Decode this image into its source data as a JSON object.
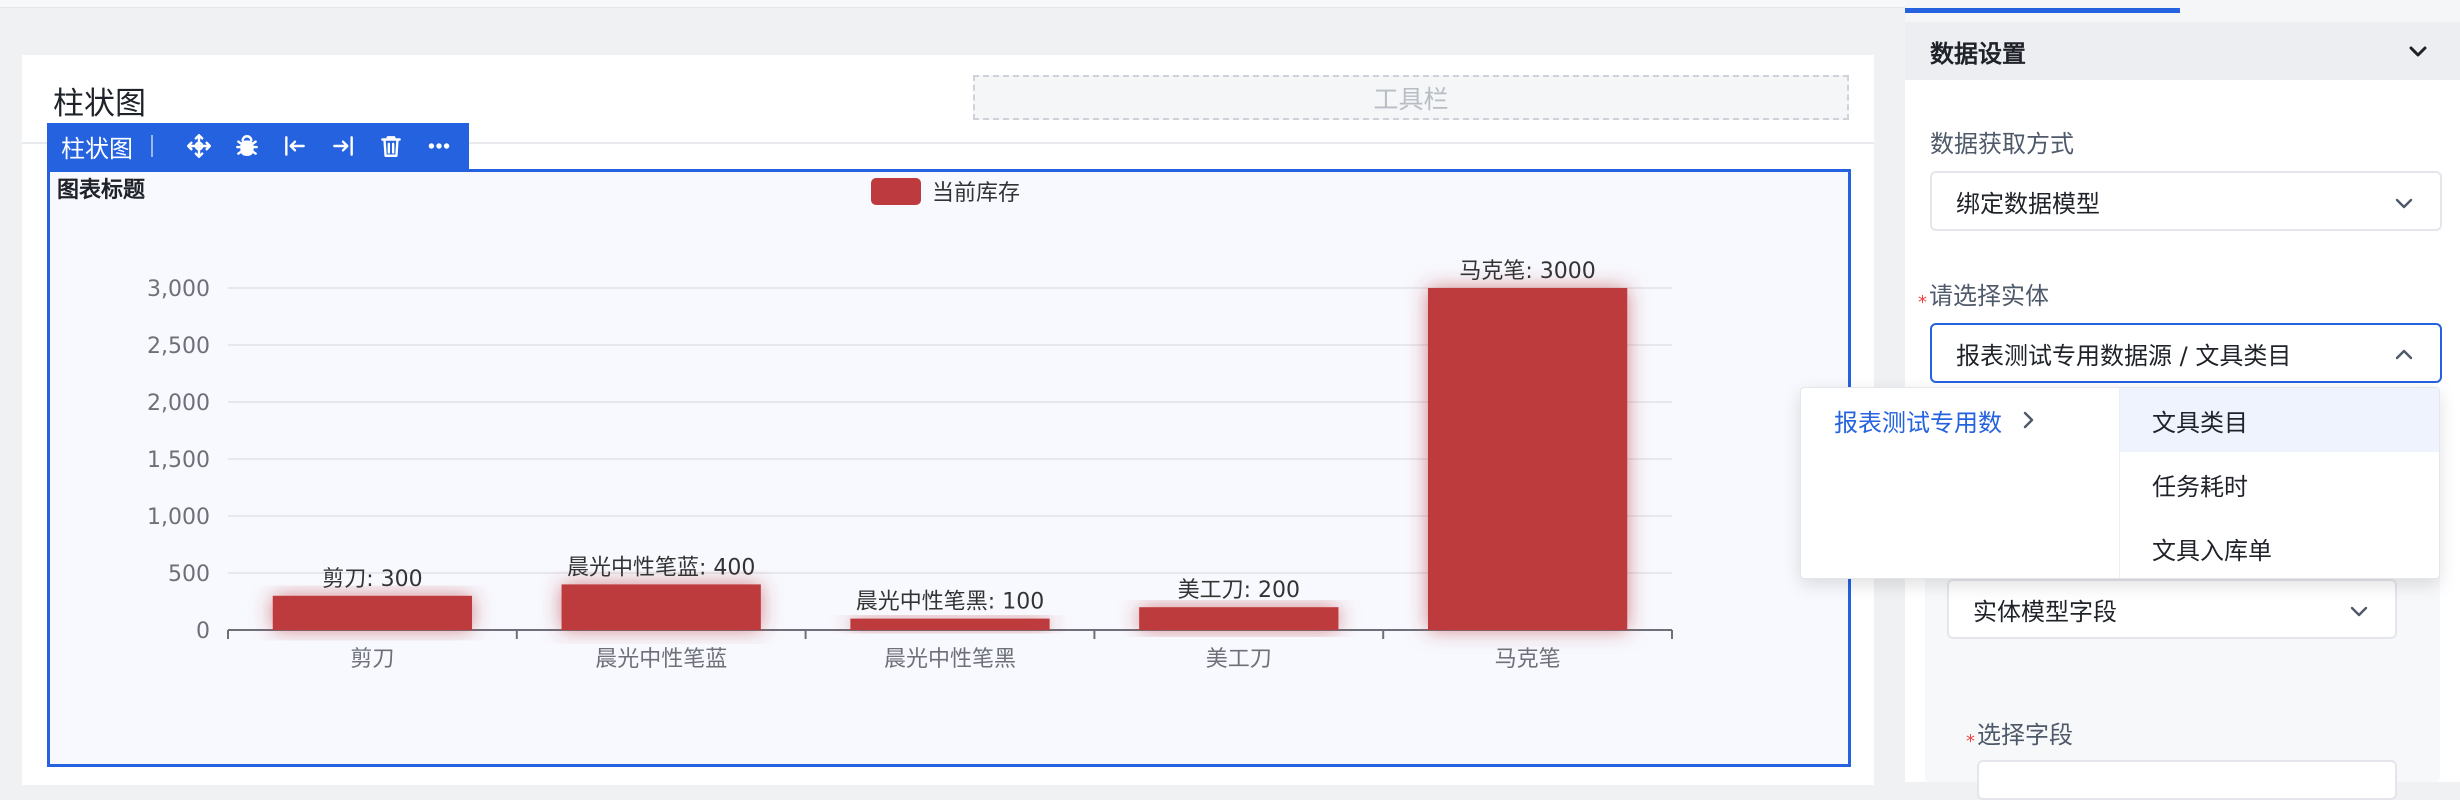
{
  "canvas": {
    "chart_component_title": "柱状图",
    "toolbar_placeholder": "工具栏"
  },
  "component_toolbar": {
    "name": "柱状图",
    "tools": [
      "move-icon",
      "debug-icon",
      "align-left-icon",
      "align-right-icon",
      "delete-icon",
      "more-icon"
    ]
  },
  "chart_data": {
    "type": "bar",
    "title": "图表标题",
    "categories": [
      "剪刀",
      "晨光中性笔蓝",
      "晨光中性笔黑",
      "美工刀",
      "马克笔"
    ],
    "series": [
      {
        "name": "当前库存",
        "values": [
          300,
          400,
          100,
          200,
          3000
        ]
      }
    ],
    "data_labels": [
      "剪刀: 300",
      "晨光中性笔蓝: 400",
      "晨光中性笔黑: 100",
      "美工刀: 200",
      "马克笔: 3000"
    ],
    "yticks": [
      "0",
      "500",
      "1,000",
      "1,500",
      "2,000",
      "2,500",
      "3,000"
    ],
    "ylim": [
      0,
      3000
    ],
    "grid": true,
    "legend_position": "top-center",
    "bar_color": "#bd3a3e"
  },
  "right_panel": {
    "section_title": "数据设置",
    "fetch_method_label": "数据获取方式",
    "fetch_method_value": "绑定数据模型",
    "entity_label": "请选择实体",
    "entity_value": "报表测试专用数据源 / 文具类目",
    "field_type_value": "实体模型字段",
    "select_field_label": "选择字段",
    "required_mark": "*"
  },
  "cascader": {
    "level1": [
      {
        "label": "报表测试专用数"
      }
    ],
    "level2": [
      {
        "label": "文具类目"
      },
      {
        "label": "任务耗时"
      },
      {
        "label": "文具入库单"
      }
    ]
  },
  "colors": {
    "accent": "#2462e0",
    "bar": "#bd3a3e"
  }
}
